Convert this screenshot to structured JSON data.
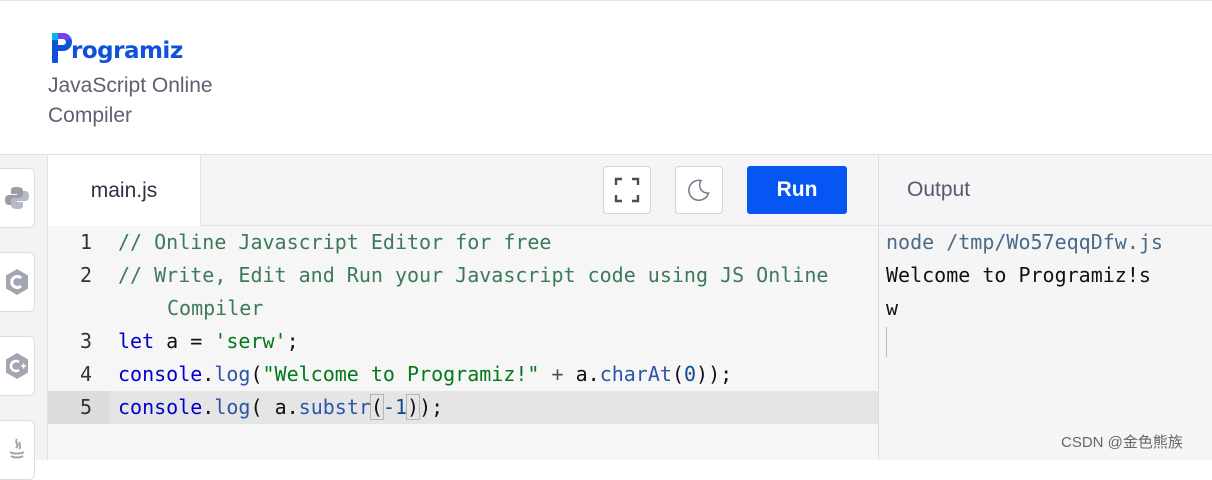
{
  "brand": {
    "logo_text": "rogramiz",
    "logo_color": "#0f51d9",
    "subtitle_line1": "JavaScript Online",
    "subtitle_line2": "Compiler"
  },
  "sidebar": {
    "languages": [
      {
        "icon": "python-icon"
      },
      {
        "icon": "c-icon"
      },
      {
        "icon": "cpp-icon"
      },
      {
        "icon": "java-icon"
      }
    ]
  },
  "editor": {
    "tab_label": "main.js",
    "fullscreen_icon": "fullscreen-icon",
    "theme_icon": "moon-icon",
    "run_label": "Run",
    "run_color": "#0556f3",
    "lines": [
      {
        "num": "1",
        "text": "// Online Javascript Editor for free"
      },
      {
        "num": "2",
        "text": "// Write, Edit and Run your Javascript code using JS Online",
        "wrap": "Compiler"
      },
      {
        "num": "3",
        "kw": "let",
        "rest": " a = ",
        "str": "'serw'",
        "end": ";"
      },
      {
        "num": "4",
        "obj": "console",
        "dot": ".",
        "fn": "log",
        "open": "(",
        "str": "\"Welcome to Programiz!\"",
        "op": " + ",
        "var": "a.",
        "fn2": "charAt",
        "p1": "(",
        "arg": "0",
        "p2": "));"
      },
      {
        "num": "5",
        "obj": "console",
        "dot": ".",
        "fn": "log",
        "open": "( ",
        "var": "a.",
        "fn2": "substr",
        "p1": "(",
        "arg": "-1",
        "p2": ")",
        "p3": ");"
      }
    ]
  },
  "output": {
    "title": "Output",
    "lines": [
      "node /tmp/Wo57eqqDfw.js",
      "Welcome to Programiz!s",
      "w"
    ]
  },
  "watermark": "CSDN @金色熊族"
}
